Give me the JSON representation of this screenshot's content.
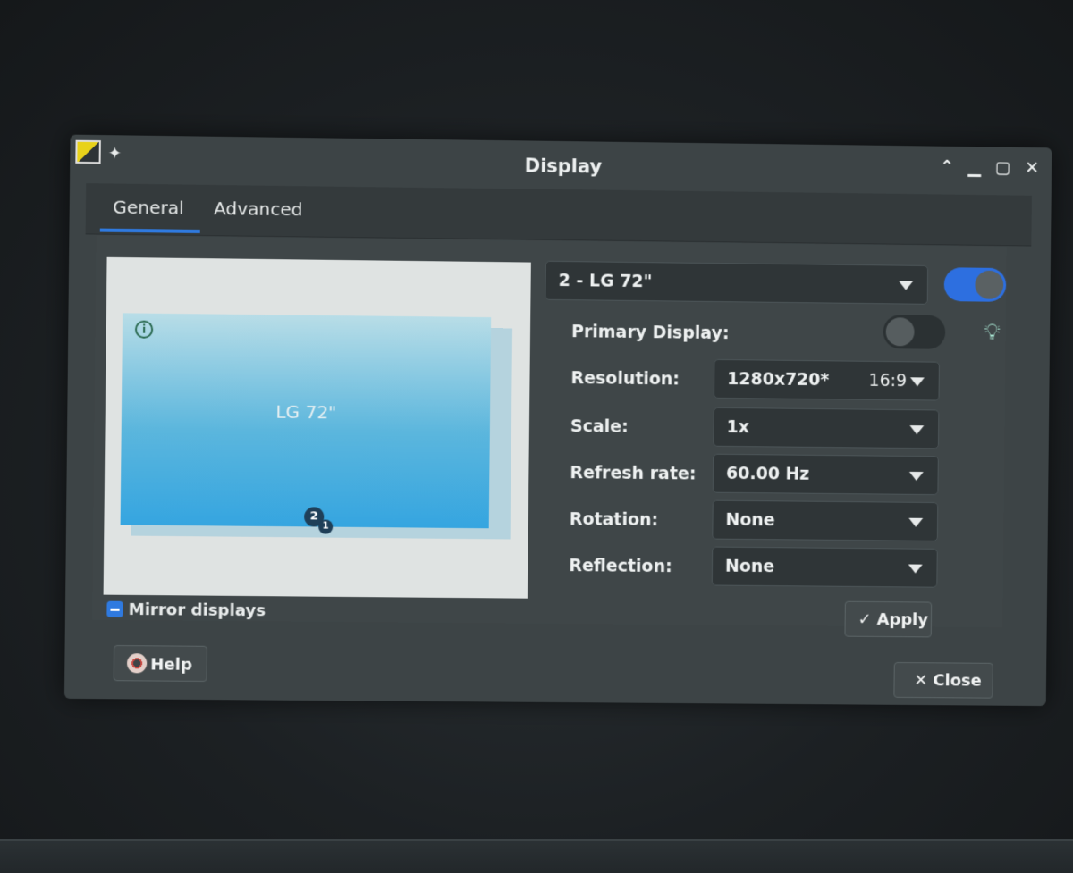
{
  "window": {
    "title": "Display",
    "controls": {
      "shade": "⌃",
      "minimize": "▁",
      "maximize": "▢",
      "close": "✕"
    }
  },
  "tabs": [
    {
      "label": "General",
      "active": true
    },
    {
      "label": "Advanced",
      "active": false
    }
  ],
  "preview": {
    "monitor_name": "LG 72\"",
    "badge_primary": "2",
    "badge_secondary": "1",
    "info_icon": "i"
  },
  "display_selector": {
    "value": "2 - LG 72\"",
    "enabled": true
  },
  "fields": {
    "primary_display": {
      "label": "Primary Display:",
      "on": false
    },
    "resolution": {
      "label": "Resolution:",
      "value": "1280x720*",
      "aspect": "16:9"
    },
    "scale": {
      "label": "Scale:",
      "value": "1x"
    },
    "refresh_rate": {
      "label": "Refresh rate:",
      "value": "60.00 Hz"
    },
    "rotation": {
      "label": "Rotation:",
      "value": "None"
    },
    "reflection": {
      "label": "Reflection:",
      "value": "None"
    }
  },
  "mirror": {
    "label": "Mirror displays",
    "state": "indeterminate"
  },
  "buttons": {
    "apply": "✓ Apply",
    "help": "Help",
    "close": "✕ Close"
  },
  "icons": {
    "app": "display-settings-icon",
    "pin": "pin-icon",
    "bulb": "lightbulb-icon",
    "help": "lifebuoy-icon"
  },
  "colors": {
    "accent": "#2f7ae0",
    "monitor": "#35a5e0"
  }
}
